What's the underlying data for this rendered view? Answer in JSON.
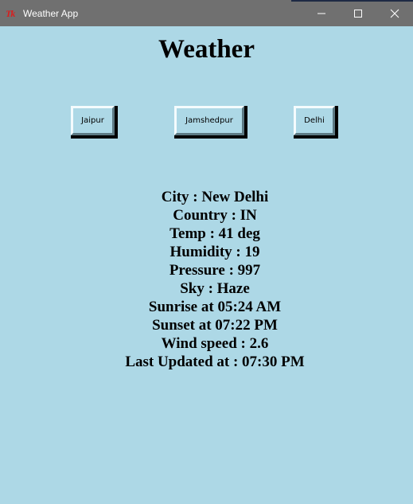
{
  "window": {
    "title": "Weather App",
    "icon": "tk-icon",
    "icon_text": "Tk",
    "controls": [
      "minimize-icon",
      "maximize-icon",
      "close-icon"
    ]
  },
  "heading": "Weather",
  "buttons": [
    {
      "label": "Jaipur"
    },
    {
      "label": "Jamshedpur"
    },
    {
      "label": "Delhi"
    }
  ],
  "info": {
    "city": "City : New Delhi",
    "country": "Country : IN",
    "temp": "Temp : 41 deg",
    "humidity": "Humidity : 19",
    "pressure": "Pressure : 997",
    "sky": "Sky : Haze",
    "sunrise": "Sunrise at 05:24 AM",
    "sunset": "Sunset at 07:22 PM",
    "wind": "Wind speed : 2.6",
    "updated": "Last Updated at : 07:30 PM"
  },
  "colors": {
    "background": "#ADD8E6",
    "titlebar": "#707070",
    "icon_red": "#d81e1e"
  }
}
